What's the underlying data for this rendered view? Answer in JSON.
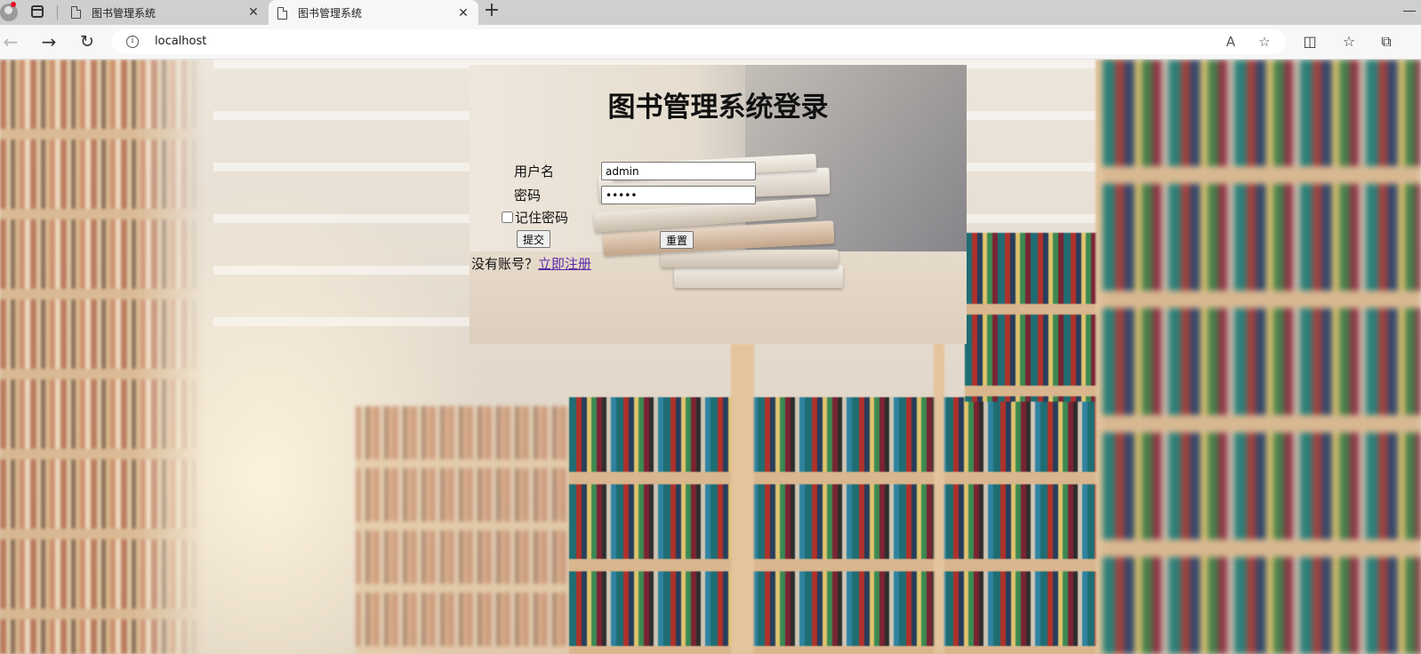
{
  "browser": {
    "tabs": [
      {
        "title": "图书管理系统",
        "active": false
      },
      {
        "title": "图书管理系统",
        "active": true
      }
    ],
    "close_glyph": "✕",
    "new_tab_glyph": "+",
    "address": {
      "url": "localhost",
      "info_glyph": "i"
    },
    "icons": {
      "back": "←",
      "forward": "→",
      "reload": "↻",
      "read_aloud": "A",
      "favorite": "☆",
      "split": "◫",
      "favorites_list": "☆",
      "collections": "⧉"
    }
  },
  "login": {
    "title": "图书管理系统登录",
    "username_label": "用户名",
    "username_value": "admin",
    "password_label": "密码",
    "password_value": "•••••",
    "remember_label": "记住密码",
    "remember_checked": false,
    "submit_label": "提交",
    "reset_label": "重置",
    "register_prompt": "没有账号？",
    "register_link": "立即注册"
  }
}
